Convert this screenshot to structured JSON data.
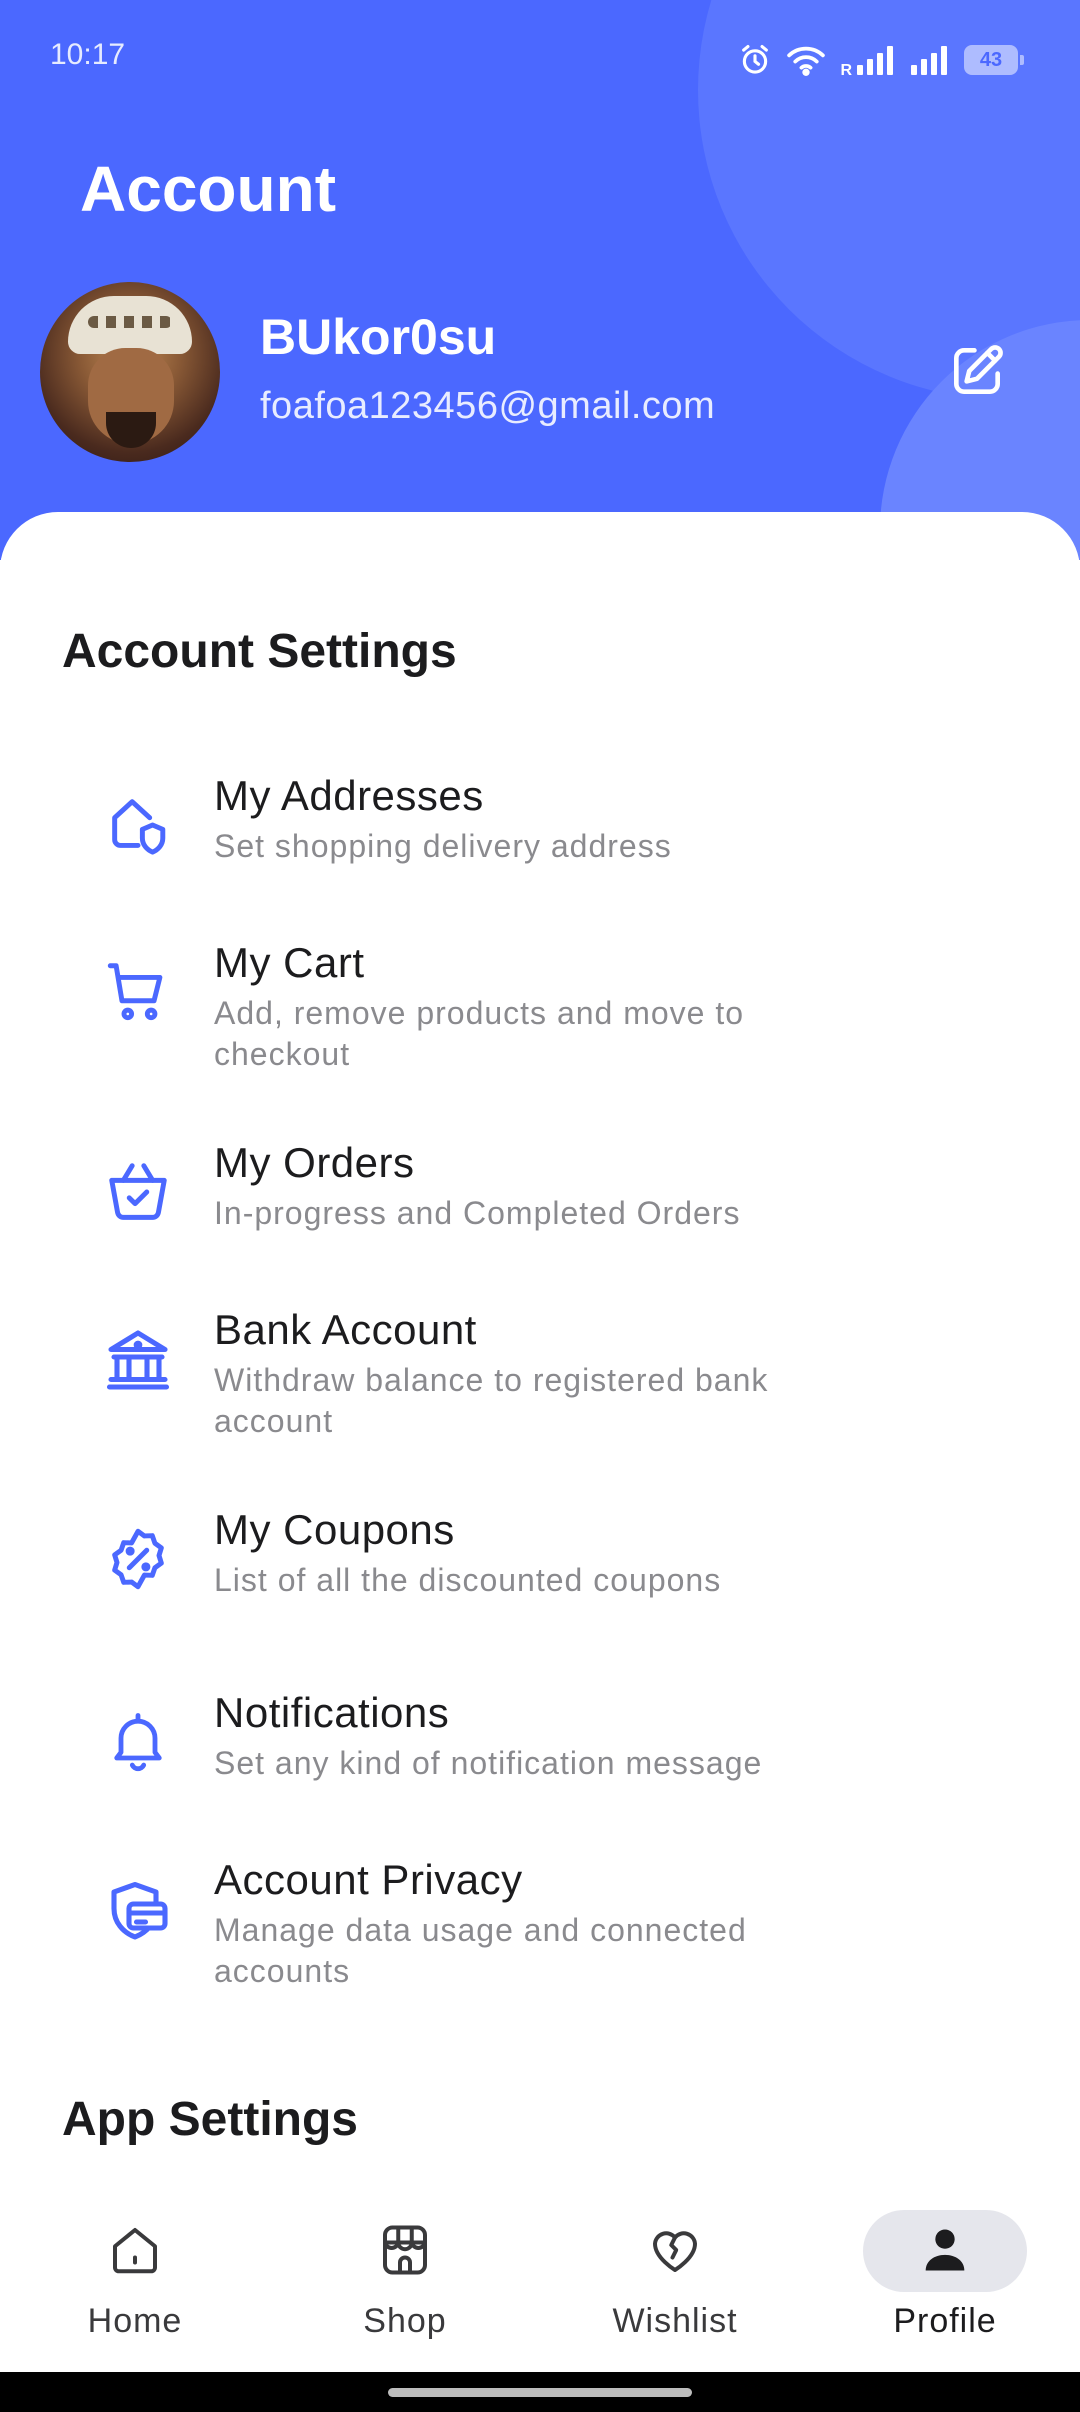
{
  "status_bar": {
    "time": "10:17",
    "network_label": "R",
    "battery": "43"
  },
  "header": {
    "title": "Account",
    "user_name": "BUkor0su",
    "user_email": "foafoa123456@gmail.com",
    "edit_icon": "edit-icon"
  },
  "account_settings": {
    "title": "Account Settings",
    "items": [
      {
        "icon": "home-shield-icon",
        "title": "My Addresses",
        "subtitle": "Set shopping delivery address"
      },
      {
        "icon": "cart-icon",
        "title": "My Cart",
        "subtitle": "Add, remove products and move to checkout"
      },
      {
        "icon": "basket-check-icon",
        "title": "My Orders",
        "subtitle": "In-progress and Completed Orders"
      },
      {
        "icon": "bank-icon",
        "title": "Bank Account",
        "subtitle": "Withdraw balance to registered bank account"
      },
      {
        "icon": "discount-badge-icon",
        "title": "My Coupons",
        "subtitle": "List of all the discounted coupons"
      },
      {
        "icon": "bell-icon",
        "title": "Notifications",
        "subtitle": "Set any kind of notification message"
      },
      {
        "icon": "security-card-icon",
        "title": "Account Privacy",
        "subtitle": "Manage data usage and connected accounts"
      }
    ]
  },
  "app_settings": {
    "title": "App Settings"
  },
  "bottom_nav": {
    "items": [
      {
        "icon": "home-icon",
        "label": "Home",
        "active": false
      },
      {
        "icon": "shop-icon",
        "label": "Shop",
        "active": false
      },
      {
        "icon": "heart-icon",
        "label": "Wishlist",
        "active": false
      },
      {
        "icon": "user-icon",
        "label": "Profile",
        "active": true
      }
    ]
  },
  "colors": {
    "primary": "#4b68ff",
    "icon_blue": "#4b68ff",
    "active_pill": "#e5e6ec"
  }
}
